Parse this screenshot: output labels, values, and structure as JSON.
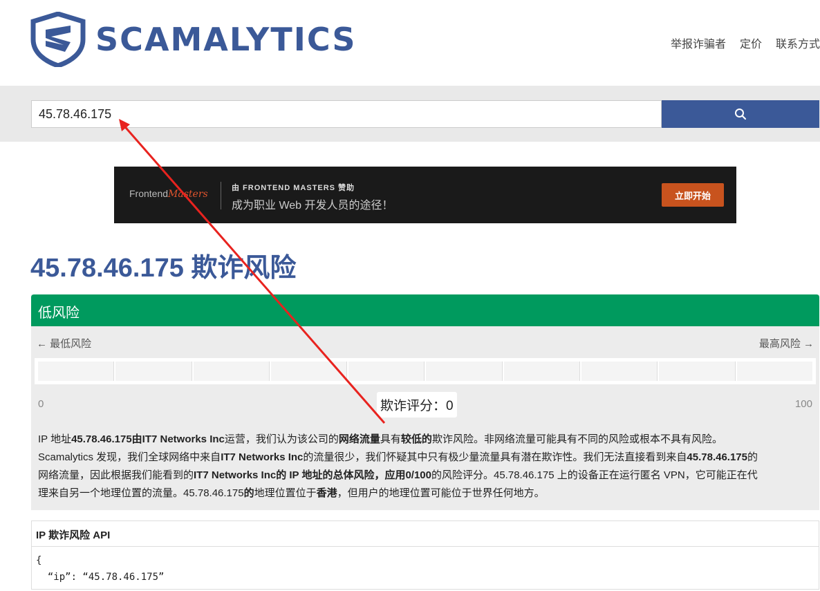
{
  "brand": {
    "name": "SCAMALYTICS",
    "color": "#3b5998"
  },
  "nav": {
    "items": [
      "举报诈骗者",
      "定价",
      "联系方式"
    ]
  },
  "search": {
    "value": "45.78.46.175",
    "button_icon": "search-icon"
  },
  "ad": {
    "brand_prefix": "Frontend",
    "brand_suffix": "Masters",
    "sponsor": "由 FRONTEND MASTERS 赞助",
    "tagline": "成为职业 Web 开发人员的途径！",
    "cta": "立即开始"
  },
  "page_title": "45.78.46.175 欺诈风险",
  "risk": {
    "level": "低风险",
    "level_color": "#009a5e",
    "low_label": "← 最低风险",
    "high_label": "最高风险 →",
    "min": "0",
    "max": "100",
    "score_label": "欺诈评分：0",
    "score": 0,
    "description": [
      [
        {
          "t": "IP 地址"
        },
        {
          "t": "45.78.46.175由IT7 Networks Inc",
          "b": true
        },
        {
          "t": "运营，我们认为该公司的"
        },
        {
          "t": "网络流量",
          "b": true
        },
        {
          "t": "具有"
        },
        {
          "t": "较低的",
          "b": true
        },
        {
          "t": "欺诈风险。非网络流量可能具有不同的风险或根本不具有风险。"
        }
      ],
      [
        {
          "t": "Scamalytics 发现，我们全球网络中来自"
        },
        {
          "t": "IT7 Networks Inc",
          "b": true
        },
        {
          "t": "的流量很少，我们怀疑其中只有极少量流量具有潜在欺诈性。我们无法直接看到来自"
        },
        {
          "t": "45.78.46.175",
          "b": true
        },
        {
          "t": "的"
        }
      ],
      [
        {
          "t": "网络流量，因此根据我们能看到的"
        },
        {
          "t": "IT7 Networks Inc的 IP 地址的总体风险，应用0/100",
          "b": true
        },
        {
          "t": "的风险评分。45.78.46.175 上的设备正在运行匿名 VPN，它可能正在代"
        }
      ],
      [
        {
          "t": "理来自另一个地理位置的流量。45.78.46.175"
        },
        {
          "t": "的",
          "b": true
        },
        {
          "t": "地理位置位于"
        },
        {
          "t": "香港",
          "b": true
        },
        {
          "t": "，但用户的地理位置可能位于世界任何地方。"
        }
      ]
    ]
  },
  "api": {
    "title": "IP 欺诈风险 API",
    "code_lines": [
      "{",
      "  “ip”: “45.78.46.175”"
    ]
  }
}
